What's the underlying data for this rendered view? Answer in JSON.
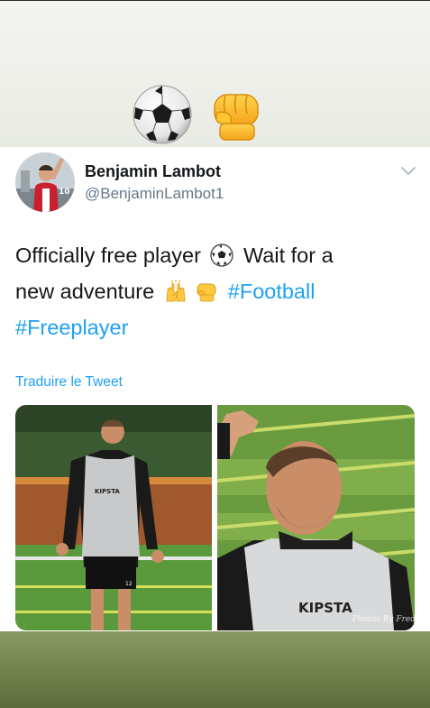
{
  "story": {
    "stickers": [
      "soccer-ball-sticker",
      "fist-bump-sticker"
    ],
    "background_top": "#eef0ea",
    "background_bottom": "#7a8a55"
  },
  "tweet": {
    "author": {
      "display_name": "Benjamin Lambot",
      "handle": "@BenjaminLambot1"
    },
    "text_line1": "Officially free player",
    "text_line1_after": "Wait for a",
    "text_line2": "new adventure",
    "hashtag1": "#Football",
    "hashtag2": "#Freeplayer",
    "translate_label": "Traduire le Tweet",
    "media": {
      "left_shirt_text": "KIPSTA",
      "right_shirt_text": "KIPSTA",
      "left_shorts_number": "12",
      "watermark": "Photos By Fred"
    },
    "colors": {
      "link": "#1da1f2",
      "text": "#14171a",
      "secondary": "#657786"
    }
  }
}
